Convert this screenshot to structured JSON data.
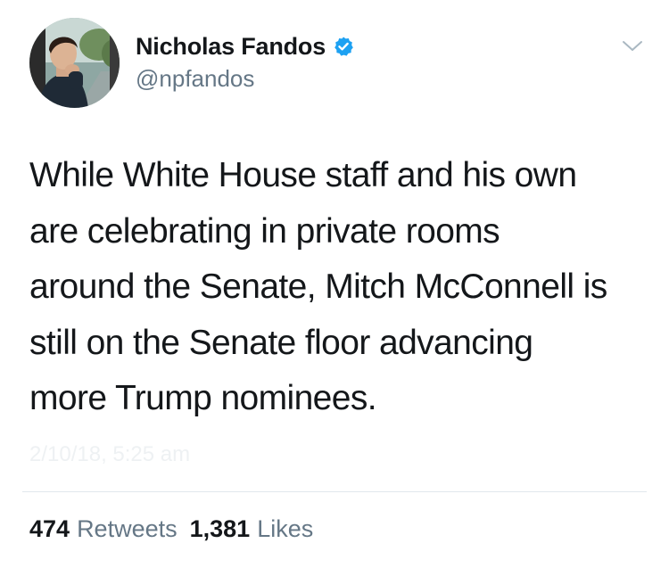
{
  "author": {
    "display_name": "Nicholas Fandos",
    "handle": "@npfandos",
    "avatar_icon": "profile-photo",
    "verified_icon": "verified-badge-icon",
    "verified_color": "#1da1f2"
  },
  "tweet": {
    "text": "While White House staff and his own\nare celebrating in private rooms\naround the Senate, Mitch McConnell is\nstill on the Senate floor advancing\nmore Trump nominees.",
    "timestamp": "2/10/18, 5:25 am"
  },
  "stats": {
    "retweets_count": "474",
    "retweets_label": "Retweets",
    "likes_count": "1,381",
    "likes_label": "Likes"
  },
  "menu": {
    "caret_icon": "chevron-down-icon"
  },
  "colors": {
    "text_primary": "#14171a",
    "text_secondary": "#657786",
    "divider": "#e1e8ed",
    "accent": "#1da1f2"
  }
}
